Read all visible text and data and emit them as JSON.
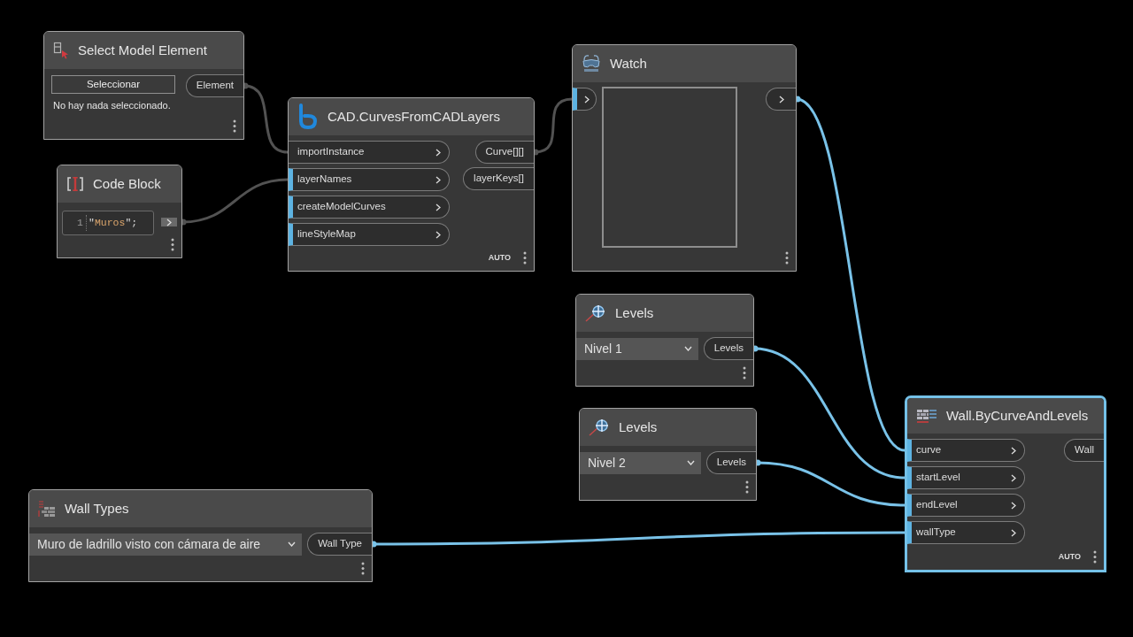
{
  "canvas": {
    "nodes": [
      {
        "kind": "selection",
        "title": "Select Model Element",
        "selected": false,
        "button": "Seleccionar",
        "message": "No hay nada seleccionado.",
        "outputs": [
          {
            "label": "Element"
          }
        ]
      },
      {
        "kind": "code",
        "title": "Code Block",
        "selected": false,
        "lines": [
          {
            "number": "1",
            "code": "\"Muros\";"
          }
        ]
      },
      {
        "kind": "function",
        "title": "CAD.CurvesFromCADLayers",
        "selected": false,
        "inputs": [
          {
            "label": "importInstance",
            "connected": true,
            "highlighted": false
          },
          {
            "label": "layerNames",
            "connected": true,
            "highlighted": true
          },
          {
            "label": "createModelCurves",
            "connected": false,
            "highlighted": true
          },
          {
            "label": "lineStyleMap",
            "connected": false,
            "highlighted": true
          }
        ],
        "outputs": [
          {
            "label": "Curve[][]"
          },
          {
            "label": "layerKeys[]"
          }
        ],
        "run_mode": "AUTO"
      },
      {
        "kind": "watch",
        "title": "Watch",
        "selected": false,
        "inputs": [
          {
            "connected": true,
            "highlighted": true
          }
        ]
      },
      {
        "kind": "dropdown",
        "title": "Levels",
        "selected": false,
        "value": "Nivel 1",
        "outputs": [
          {
            "label": "Levels"
          }
        ]
      },
      {
        "kind": "dropdown",
        "title": "Levels",
        "selected": false,
        "value": "Nivel 2",
        "outputs": [
          {
            "label": "Levels"
          }
        ]
      },
      {
        "kind": "dropdown",
        "title": "Wall Types",
        "selected": false,
        "value": "Muro de ladrillo visto con cámara de aire",
        "outputs": [
          {
            "label": "Wall Type"
          }
        ]
      },
      {
        "kind": "function",
        "title": "Wall.ByCurveAndLevels",
        "selected": true,
        "inputs": [
          {
            "label": "curve",
            "connected": true,
            "highlighted": true
          },
          {
            "label": "startLevel",
            "connected": true,
            "highlighted": true
          },
          {
            "label": "endLevel",
            "connected": true,
            "highlighted": true
          },
          {
            "label": "wallType",
            "connected": true,
            "highlighted": true
          }
        ],
        "outputs": [
          {
            "label": "Wall"
          }
        ],
        "run_mode": "AUTO"
      }
    ]
  }
}
